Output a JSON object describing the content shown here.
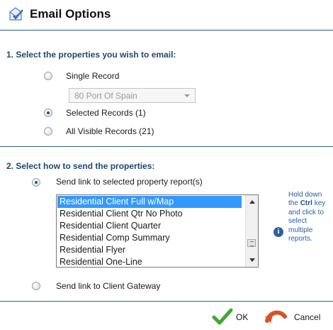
{
  "header": {
    "title": "Email Options",
    "icon": "email-checkmark-icon"
  },
  "section1": {
    "title": "1. Select the properties you wish to email:",
    "options": [
      {
        "label": "Single Record",
        "checked": false
      },
      {
        "label": "Selected Records (1)",
        "checked": true
      },
      {
        "label": "All Visible Records (21)",
        "checked": false
      }
    ],
    "record_select": {
      "value": "80 Port Of Spain"
    }
  },
  "section2": {
    "title": "2. Select how to send the properties:",
    "options": [
      {
        "label": "Send link to selected property report(s)",
        "checked": true
      },
      {
        "label": "Send link to Client Gateway",
        "checked": false
      }
    ],
    "reports": [
      "Residential Client Full w/Map",
      "Residential Client Qtr No Photo",
      "Residential Client Quarter",
      "Residential Comp Summary",
      "Residential Flyer",
      "Residential One-Line"
    ],
    "selected_report_index": 0,
    "hint": {
      "before": "Hold down the",
      "key": "Ctrl",
      "after": "key and click to select multiple reports."
    }
  },
  "buttons": {
    "ok": "OK",
    "cancel": "Cancel"
  },
  "colors": {
    "accent": "#1f4870",
    "selection": "#3399ff",
    "hint": "#2b5fa6",
    "rule": "#2f5f86"
  }
}
